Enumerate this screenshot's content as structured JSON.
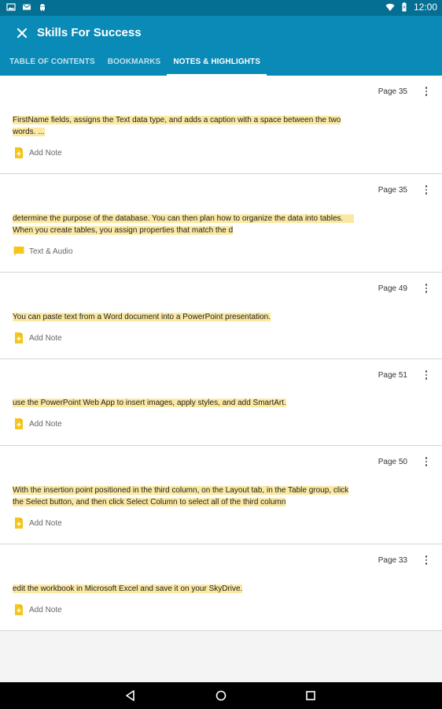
{
  "status_bar": {
    "time": "12:00"
  },
  "app_bar": {
    "title": "Skills For Success"
  },
  "tabs": [
    {
      "label": "TABLE OF CONTENTS",
      "active": false
    },
    {
      "label": "BOOKMARKS",
      "active": false
    },
    {
      "label": "NOTES & HIGHLIGHTS",
      "active": true
    }
  ],
  "notes": [
    {
      "page": "Page 35",
      "text": "FirstName fields, assigns the Text data type, and adds a caption with a space between the two words. ...",
      "action": "Add Note",
      "action_icon": "add-note-icon"
    },
    {
      "page": "Page 35",
      "text": "determine the purpose of the database. You can then plan how to organize the data into tables.     When you create tables, you assign properties that match the d",
      "action": "Text & Audio",
      "action_icon": "text-audio-note-icon"
    },
    {
      "page": "Page 49",
      "text": "You can paste text from a Word document into a PowerPoint presentation.",
      "action": "Add Note",
      "action_icon": "add-note-icon"
    },
    {
      "page": "Page 51",
      "text": " use the PowerPoint Web App to insert images, apply styles, and add SmartArt.",
      "action": "Add Note",
      "action_icon": "add-note-icon"
    },
    {
      "page": "Page 50",
      "text": "With the insertion point positioned in the third column, on the Layout tab, in the Table group, click the Select button, and then click Select Column to select all of the third column",
      "action": "Add Note",
      "action_icon": "add-note-icon"
    },
    {
      "page": "Page 33",
      "text": "edit the workbook in Microsoft Excel and save it on your SkyDrive.",
      "action": "Add Note",
      "action_icon": "add-note-icon"
    }
  ],
  "colors": {
    "app_bar": "#0a8ab6",
    "status_bar": "#046f92",
    "highlight": "#fbe8a3",
    "note_icon": "#f5c518"
  }
}
